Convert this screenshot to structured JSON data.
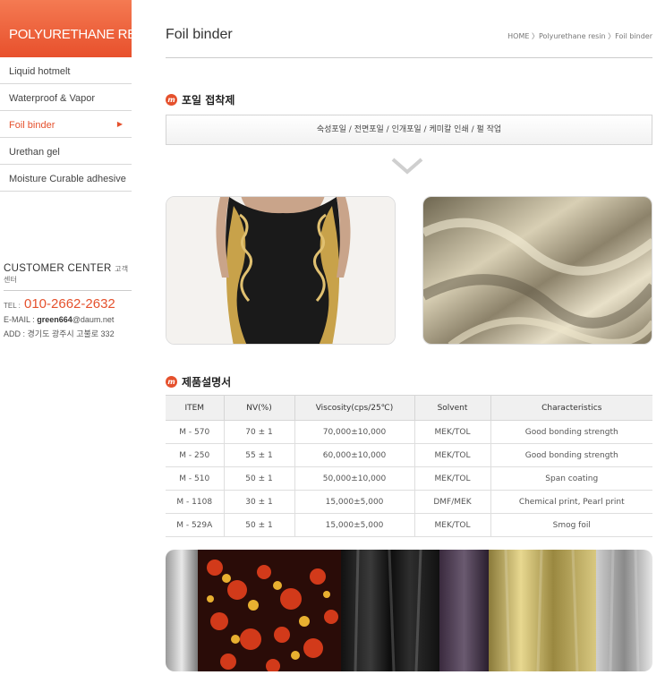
{
  "sidebar": {
    "banner_title": "POLYURETHANE RESIN",
    "items": [
      {
        "label": "Liquid hotmelt"
      },
      {
        "label": "Waterproof & Vapor"
      },
      {
        "label": "Foil binder",
        "arrow": "▶"
      },
      {
        "label": "Urethan gel"
      },
      {
        "label": "Moisture Curable adhesive"
      }
    ]
  },
  "customer_center": {
    "title": "CUSTOMER CENTER",
    "title_kr": "고객센터",
    "tel_label": "TEL :",
    "tel": "010-2662-2632",
    "email_label": "E-MAIL :",
    "email_user": "green664",
    "email_domain": "@daum.net",
    "addr_label": "ADD :",
    "addr": "경기도 광주시 고불로 332"
  },
  "header": {
    "title": "Foil binder",
    "breadcrumb": "HOME 〉Polyurethane resin 〉Foil binder"
  },
  "section1": {
    "icon_letter": "m",
    "title": "포일 접착제",
    "features": "숙성포일 / 전면포일 / 인개포일 / 케미칼 인쇄 / 펄 작업"
  },
  "section2": {
    "icon_letter": "m",
    "title": "제품설명서"
  },
  "table": {
    "headers": [
      "ITEM",
      "NV(%)",
      "Viscosity(cps/25℃)",
      "Solvent",
      "Characteristics"
    ],
    "rows": [
      [
        "M - 570",
        "70 ± 1",
        "70,000±10,000",
        "MEK/TOL",
        "Good bonding strength"
      ],
      [
        "M - 250",
        "55 ± 1",
        "60,000±10,000",
        "MEK/TOL",
        "Good bonding strength"
      ],
      [
        "M - 510",
        "50 ± 1",
        "50,000±10,000",
        "MEK/TOL",
        "Span coating"
      ],
      [
        "M - 1108",
        "30 ± 1",
        "15,000±5,000",
        "DMF/MEK",
        "Chemical print, Pearl print"
      ],
      [
        "M - 529A",
        "50 ± 1",
        "15,000±5,000",
        "MEK/TOL",
        "Smog foil"
      ]
    ]
  },
  "colors": {
    "accent": "#e5512d",
    "border": "#d8d8d8"
  }
}
